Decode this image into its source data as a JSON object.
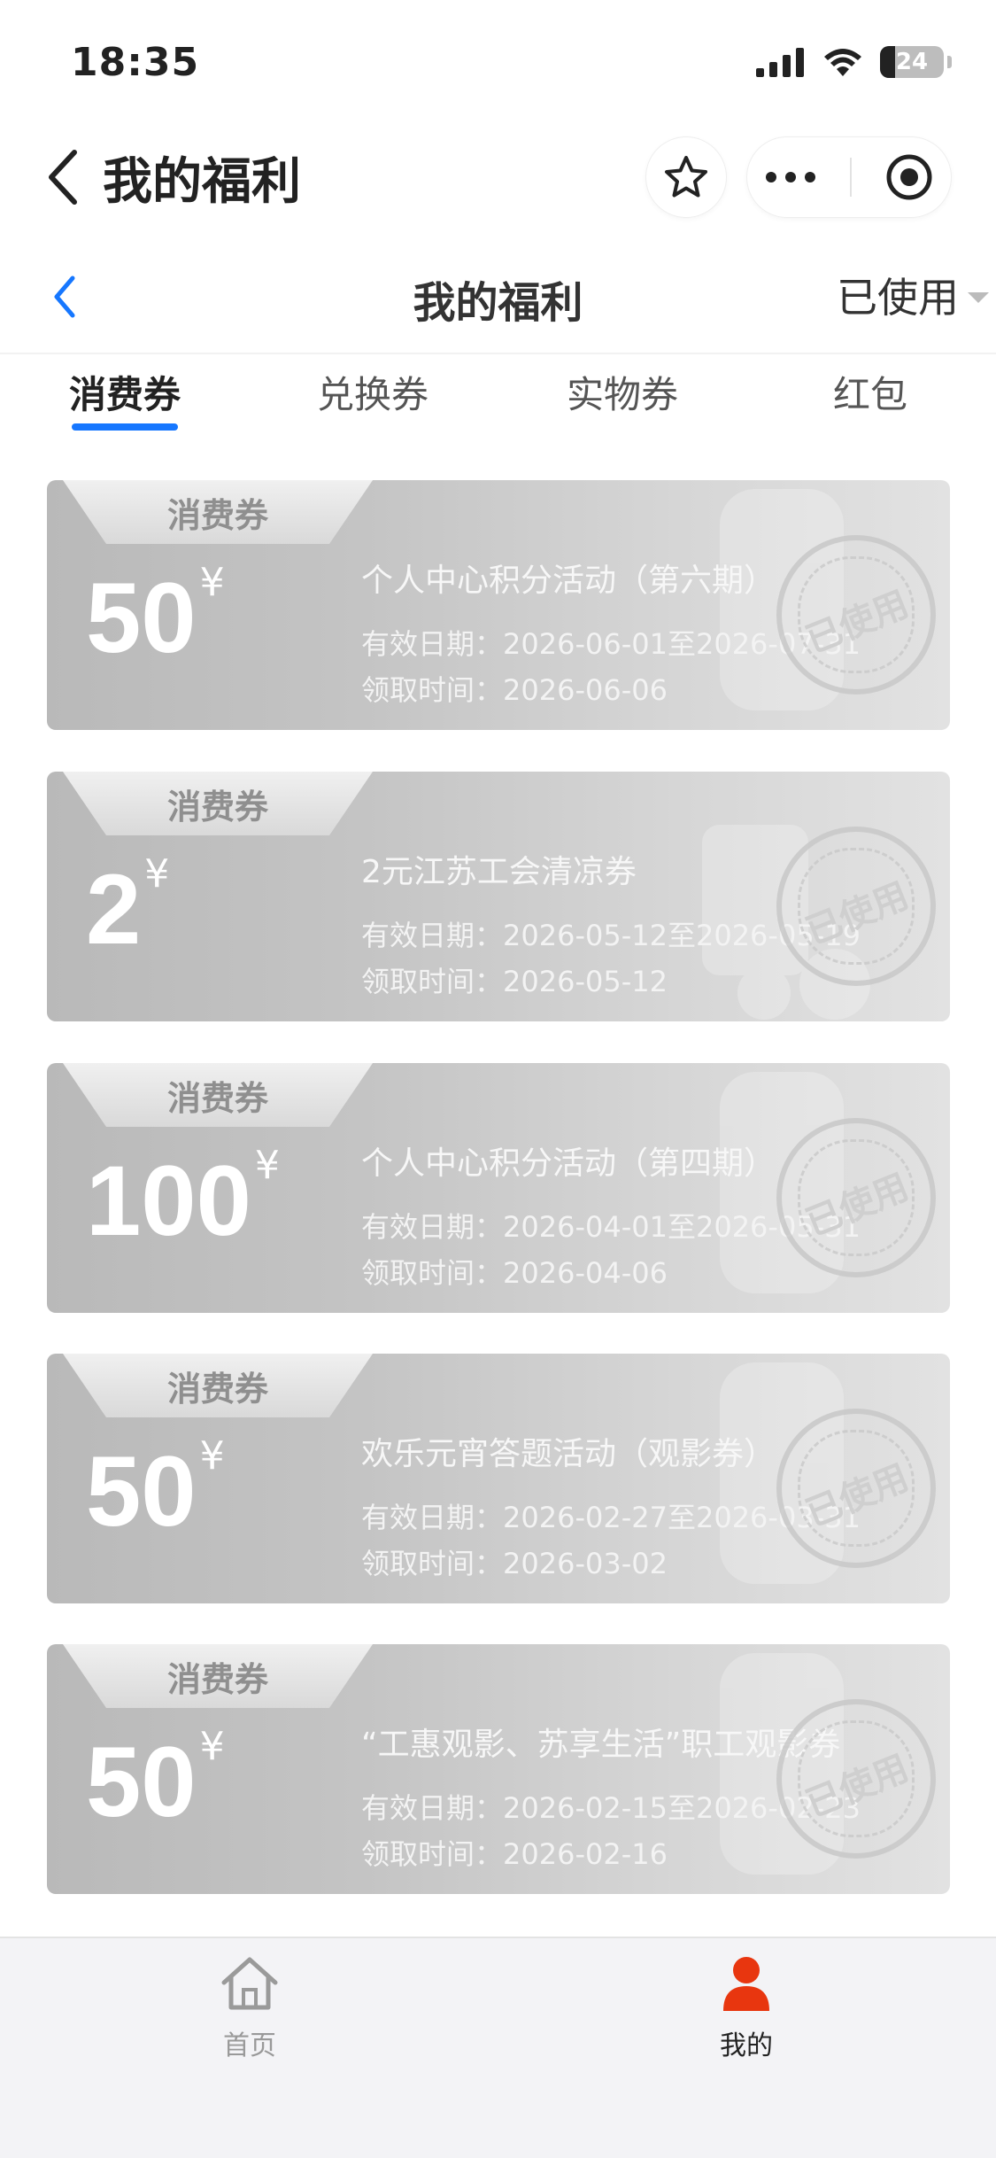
{
  "status_bar": {
    "time": "18:35",
    "battery": "24",
    "battery_level": 0.24
  },
  "mini_nav": {
    "title": "我的福利"
  },
  "page": {
    "title": "我的福利",
    "filter": "已使用"
  },
  "tabs": [
    {
      "label": "消费券",
      "active": true
    },
    {
      "label": "兑换券",
      "active": false
    },
    {
      "label": "实物券",
      "active": false
    },
    {
      "label": "红包",
      "active": false
    }
  ],
  "coupons": [
    {
      "tag": "消费券",
      "amount": "50",
      "currency": "¥",
      "name": "个人中心积分活动（第六期）",
      "valid": "有效日期：2026-06-01至2026-07-31",
      "received": "领取时间：2026-06-06",
      "stamp": "已使用"
    },
    {
      "tag": "消费券",
      "amount": "2",
      "currency": "¥",
      "name": "2元江苏工会清凉券",
      "valid": "有效日期：2026-05-12至2026-05-19",
      "received": "领取时间：2026-05-12",
      "stamp": "已使用"
    },
    {
      "tag": "消费券",
      "amount": "100",
      "currency": "¥",
      "name": "个人中心积分活动（第四期）",
      "valid": "有效日期：2026-04-01至2026-05-31",
      "received": "领取时间：2026-04-06",
      "stamp": "已使用"
    },
    {
      "tag": "消费券",
      "amount": "50",
      "currency": "¥",
      "name": "欢乐元宵答题活动（观影券）",
      "valid": "有效日期：2026-02-27至2026-03-31",
      "received": "领取时间：2026-03-02",
      "stamp": "已使用"
    },
    {
      "tag": "消费券",
      "amount": "50",
      "currency": "¥",
      "name": "“工惠观影、苏享生活”职工观影券",
      "valid": "有效日期：2026-02-15至2026-02-23",
      "received": "领取时间：2026-02-16",
      "stamp": "已使用"
    }
  ],
  "tab_bar": {
    "home": {
      "label": "首页",
      "icon": "home-icon"
    },
    "mine": {
      "label": "我的",
      "icon": "user-icon",
      "active": true
    }
  },
  "colors": {
    "accent": "#1677ff",
    "active_tab": "#e8360f"
  }
}
